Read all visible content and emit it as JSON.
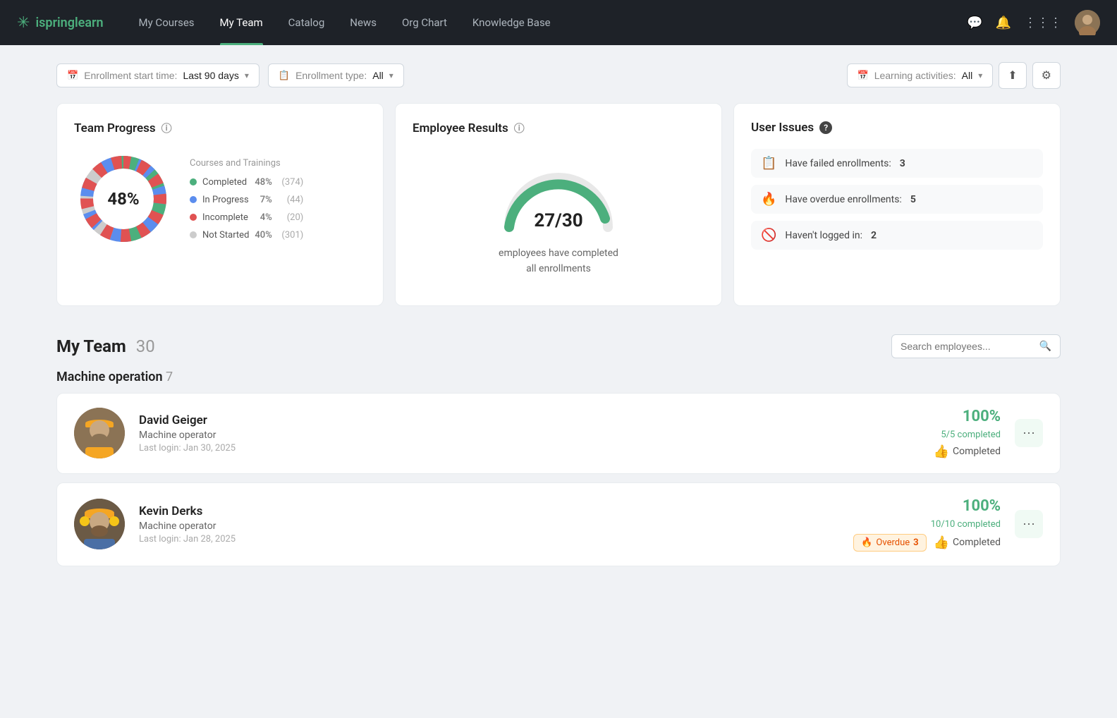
{
  "navbar": {
    "logo_text": "ispring",
    "logo_accent": "learn",
    "links": [
      {
        "label": "My Courses",
        "active": false
      },
      {
        "label": "My Team",
        "active": true
      },
      {
        "label": "Catalog",
        "active": false
      },
      {
        "label": "News",
        "active": false
      },
      {
        "label": "Org Chart",
        "active": false
      },
      {
        "label": "Knowledge Base",
        "active": false
      }
    ]
  },
  "filters": {
    "enrollment_start_label": "Enrollment start time:",
    "enrollment_start_value": "Last 90 days",
    "enrollment_type_label": "Enrollment type:",
    "enrollment_type_value": "All",
    "learning_activities_label": "Learning activities:",
    "learning_activities_value": "All"
  },
  "team_progress": {
    "title": "Team Progress",
    "center_pct": "48%",
    "legend_title": "Courses and Trainings",
    "items": [
      {
        "label": "Completed",
        "color": "#4caf7d",
        "pct": "48%",
        "count": "(374)"
      },
      {
        "label": "In Progress",
        "color": "#5b8dee",
        "pct": "7%",
        "count": "(44)"
      },
      {
        "label": "Incomplete",
        "color": "#e05252",
        "pct": "4%",
        "count": "(20)"
      },
      {
        "label": "Not Started",
        "color": "#cccccc",
        "pct": "40%",
        "count": "(301)"
      }
    ]
  },
  "employee_results": {
    "title": "Employee Results",
    "numerator": "27",
    "denominator": "30",
    "fraction": "27/30",
    "description": "employees have completed\nall enrollments"
  },
  "user_issues": {
    "title": "User Issues",
    "items": [
      {
        "emoji": "📋",
        "text": "Have failed enrollments:",
        "count": "3"
      },
      {
        "emoji": "🔥",
        "text": "Have overdue enrollments:",
        "count": "5"
      },
      {
        "emoji": "🚫",
        "text": "Haven't logged in:",
        "count": "2"
      }
    ]
  },
  "my_team": {
    "title": "My Team",
    "count": "30",
    "search_placeholder": "Search employees...",
    "groups": [
      {
        "name": "Machine operation",
        "count": "7",
        "employees": [
          {
            "name": "David Geiger",
            "role": "Machine operator",
            "last_login": "Last login: Jan 30, 2025",
            "pct": "100%",
            "completed_label": "5/5 completed",
            "status": "completed",
            "status_label": "Completed",
            "status_emoji": "👍",
            "overdue": null
          },
          {
            "name": "Kevin Derks",
            "role": "Machine operator",
            "last_login": "Last login: Jan 28, 2025",
            "pct": "100%",
            "completed_label": "10/10 completed",
            "status": "completed",
            "status_label": "Completed",
            "status_emoji": "👍",
            "overdue": "3",
            "overdue_emoji": "🔥"
          }
        ]
      }
    ]
  },
  "colors": {
    "green": "#4caf7d",
    "blue": "#5b8dee",
    "red": "#e05252",
    "gray": "#cccccc",
    "accent": "#4caf7d"
  }
}
